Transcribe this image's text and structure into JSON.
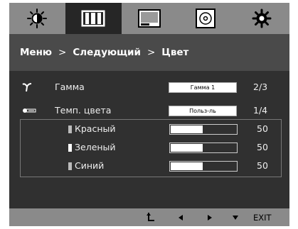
{
  "tabs": [
    {
      "icon": "brightness-sun-icon"
    },
    {
      "icon": "color-bars-icon"
    },
    {
      "icon": "display-screen-icon"
    },
    {
      "icon": "disc-icon"
    },
    {
      "icon": "settings-gear-icon"
    }
  ],
  "active_tab": 1,
  "breadcrumb": {
    "menu": "Меню",
    "next": "Следующий",
    "current": "Цвет",
    "separator": ">"
  },
  "rows": {
    "gamma": {
      "icon": "gamma-icon",
      "label": "Гамма",
      "value": "Гамма 1",
      "counter": "2/3"
    },
    "color_temp": {
      "icon": "color-temp-icon",
      "label": "Темп. цвета",
      "value": "Польз-ль",
      "counter": "1/4"
    }
  },
  "sub_settings": [
    {
      "label": "Красный",
      "value": "50",
      "level": 0.5
    },
    {
      "label": "Зеленый",
      "value": "50",
      "level": 0.5
    },
    {
      "label": "Синий",
      "value": "50",
      "level": 0.5
    }
  ],
  "bottom": {
    "exit_label": "EXIT"
  },
  "colors": {
    "panel": "#303030",
    "tab_bar": "#8a8a8a",
    "active_tab": "#262626",
    "breadcrumb_bg": "#4a4a4a"
  }
}
